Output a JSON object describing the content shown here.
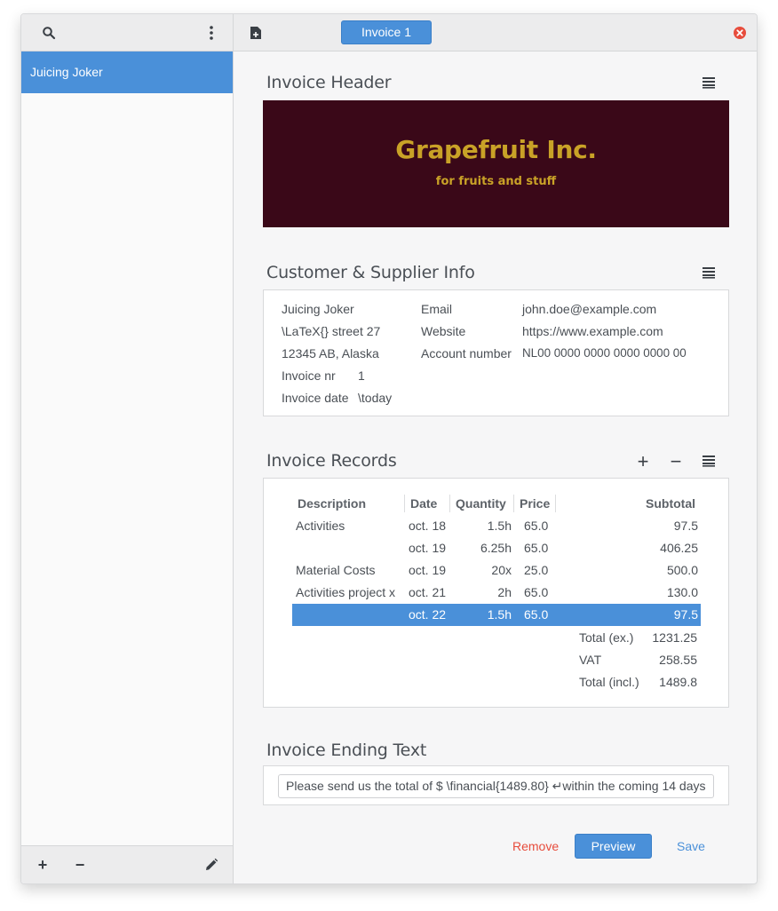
{
  "sidebar": {
    "items": [
      {
        "label": "Juicing Joker"
      }
    ],
    "footer": {
      "add": "+",
      "remove": "−"
    }
  },
  "tabs": [
    {
      "label": "Invoice 1"
    }
  ],
  "header_section": {
    "title": "Invoice Header",
    "company": "Grapefruit Inc.",
    "tagline": "for fruits and stuff"
  },
  "info_section": {
    "title": "Customer & Supplier Info",
    "customer": {
      "name": "Juicing Joker",
      "street": "\\LaTeX{} street 27",
      "city": "12345 AB, Alaska",
      "invoice_nr_label": "Invoice nr",
      "invoice_nr": "1",
      "invoice_date_label": "Invoice date",
      "invoice_date": "\\today"
    },
    "supplier": {
      "email_label": "Email",
      "email": "john.doe@example.com",
      "website_label": "Website",
      "website": "https://www.example.com",
      "account_label": "Account number",
      "account": "NL00 0000 0000 0000 0000 00"
    }
  },
  "records_section": {
    "title": "Invoice Records",
    "add": "+",
    "remove": "−",
    "columns": {
      "description": "Description",
      "date": "Date",
      "quantity": "Quantity",
      "price": "Price",
      "subtotal": "Subtotal"
    },
    "rows": [
      {
        "description": "Activities",
        "date": "oct. 18",
        "quantity": "1.5h",
        "price": "65.0",
        "subtotal": "97.5"
      },
      {
        "description": "",
        "date": "oct. 19",
        "quantity": "6.25h",
        "price": "65.0",
        "subtotal": "406.25"
      },
      {
        "description": "Material Costs",
        "date": "oct. 19",
        "quantity": "20x",
        "price": "25.0",
        "subtotal": "500.0"
      },
      {
        "description": "Activities project x",
        "date": "oct. 21",
        "quantity": "2h",
        "price": "65.0",
        "subtotal": "130.0"
      },
      {
        "description": "",
        "date": "oct. 22",
        "quantity": "1.5h",
        "price": "65.0",
        "subtotal": "97.5"
      }
    ],
    "totals": [
      {
        "label": "Total (ex.)",
        "value": "1231.25"
      },
      {
        "label": "VAT",
        "value": "258.55"
      },
      {
        "label": "Total (incl.)",
        "value": "1489.8"
      }
    ]
  },
  "ending_section": {
    "title": "Invoice Ending Text",
    "value": "Please send us the total of $ \\financial{1489.80} ↵within the coming 14 days"
  },
  "actions": {
    "remove": "Remove",
    "preview": "Preview",
    "save": "Save"
  },
  "colors": {
    "accent": "#4a90d9",
    "banner_bg": "#3a0818",
    "banner_text": "#c9a227",
    "danger": "#e74c3c"
  }
}
